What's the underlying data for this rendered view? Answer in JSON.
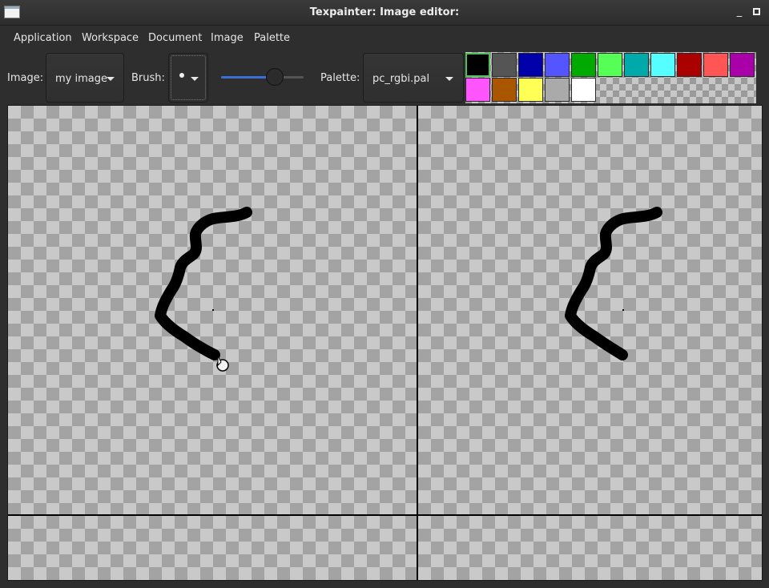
{
  "window": {
    "title": "Texpainter: Image editor:",
    "minimize_glyph": "_",
    "icon": "app-window-icon"
  },
  "menubar": {
    "items": [
      "Application",
      "Workspace",
      "Document",
      "Image",
      "Palette"
    ]
  },
  "toolbar": {
    "image_label": "Image:",
    "image_value": "my image",
    "brush_label": "Brush:",
    "brush_icon": "round-brush-icon",
    "brush_size_fraction": 0.65,
    "palette_label": "Palette:",
    "palette_value": "pc_rgbi.pal",
    "accent": "#3b6fd8"
  },
  "palette": {
    "selected_index": 0,
    "colors": [
      "#000000",
      "#555555",
      "#0000aa",
      "#5555ff",
      "#00aa00",
      "#55ff55",
      "#00aaaa",
      "#55ffff",
      "#aa0000",
      "#ff5555",
      "#aa00aa",
      "#ff55ff",
      "#aa5500",
      "#ffff55",
      "#aaaaaa",
      "#ffffff"
    ]
  },
  "canvas": {
    "background": "transparent-checkerboard",
    "views": [
      "tiled-view-left",
      "tiled-view-right"
    ],
    "stroke_color": "#000000",
    "cursor": "brush-cursor-icon"
  }
}
